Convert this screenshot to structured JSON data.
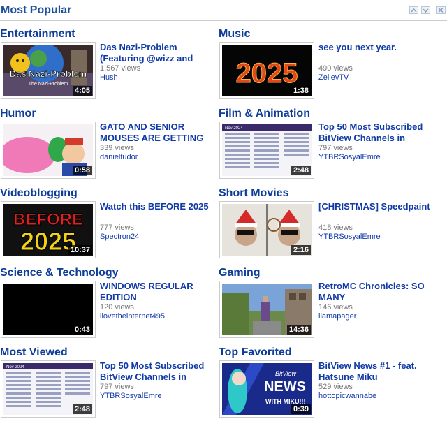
{
  "header": {
    "title": "Most Popular"
  },
  "categories": [
    {
      "title": "Entertainment",
      "video": {
        "title": "Das Nazi-Problem (Featuring @wizz and",
        "views": "1,567 views",
        "user": "Hush",
        "duration": "4:05",
        "thumb_text": "Das Nazi-Problem",
        "thumb_subtext": "The Nazi-Problem"
      }
    },
    {
      "title": "Music",
      "video": {
        "title": "see you next year.",
        "views": "490 views",
        "user": "ZellevTV",
        "duration": "1:38",
        "thumb_text": "2025"
      }
    },
    {
      "title": "Humor",
      "video": {
        "title": "GATO AND SENIOR MOUSES ARE GETTING",
        "views": "339 views",
        "user": "danieltudor",
        "duration": "0:58"
      }
    },
    {
      "title": "Film & Animation",
      "video": {
        "title": "Top 50 Most Subscribed BitView Channels in",
        "views": "797 views",
        "user": "YTBRSosyalEmre",
        "duration": "2:48",
        "thumb_text": "Nov 2024"
      }
    },
    {
      "title": "Videoblogging",
      "video": {
        "title": "Watch this BEFORE 2025",
        "views": "777 views",
        "user": "Spectron24",
        "duration": "10:37",
        "thumb_text": "BEFORE",
        "thumb_subtext": "2025"
      }
    },
    {
      "title": "Short Movies",
      "video": {
        "title": "[CHRISTMAS] Speedpaint",
        "views": "418 views",
        "user": "YTBRSosyalEmre",
        "duration": "2:16"
      }
    },
    {
      "title": "Science & Technology",
      "video": {
        "title": "WINDOWS REGULAR EDITION",
        "views": "120 views",
        "user": "ilovetheinternet495",
        "duration": "0:43"
      }
    },
    {
      "title": "Gaming",
      "video": {
        "title": "RetroMC Chronicles: SO MANY",
        "views": "146 views",
        "user": "llamapager",
        "duration": "14:36"
      }
    },
    {
      "title": "Most Viewed",
      "video": {
        "title": "Top 50 Most Subscribed BitView Channels in",
        "views": "797 views",
        "user": "YTBRSosyalEmre",
        "duration": "2:48",
        "thumb_text": "Nov 2024"
      }
    },
    {
      "title": "Top Favorited",
      "video": {
        "title": "BitView News #1 - feat. Hatsune Miku",
        "views": "529 views",
        "user": "hottopicwannabe",
        "duration": "0:39",
        "thumb_text": "BitView",
        "thumb_subtext": "NEWS",
        "thumb_subtext2": "WITH MIKU!!!"
      }
    }
  ]
}
